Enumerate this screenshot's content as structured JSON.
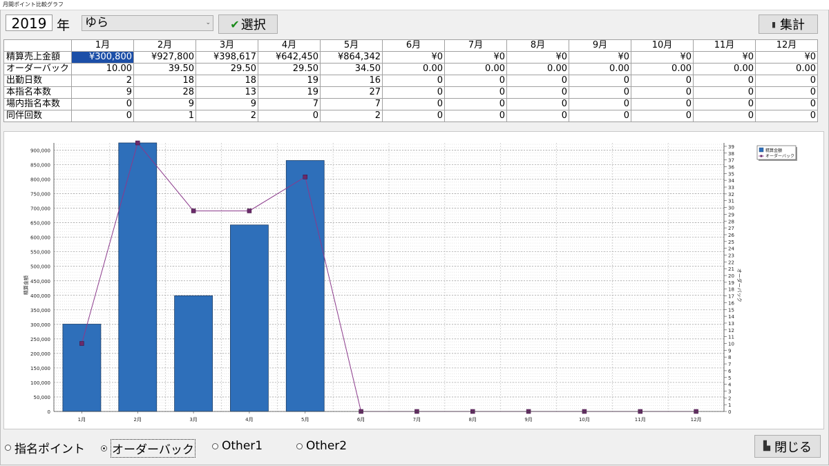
{
  "window": {
    "title": "月間ポイント比較グラフ"
  },
  "toolbar": {
    "year_value": "2019",
    "year_label": "年",
    "staff_selected": "ゆら",
    "select_button": "選択",
    "sum_button": "集計"
  },
  "table": {
    "columns": [
      "1月",
      "2月",
      "3月",
      "4月",
      "5月",
      "6月",
      "7月",
      "8月",
      "9月",
      "10月",
      "11月",
      "12月"
    ],
    "rows": [
      {
        "label": "精算売上金額",
        "values": [
          "¥300,800",
          "¥927,800",
          "¥398,617",
          "¥642,450",
          "¥864,342",
          "¥0",
          "¥0",
          "¥0",
          "¥0",
          "¥0",
          "¥0",
          "¥0"
        ]
      },
      {
        "label": "オーダーバック",
        "values": [
          "10.00",
          "39.50",
          "29.50",
          "29.50",
          "34.50",
          "0.00",
          "0.00",
          "0.00",
          "0.00",
          "0.00",
          "0.00",
          "0.00"
        ]
      },
      {
        "label": "出勤日数",
        "values": [
          "2",
          "18",
          "18",
          "19",
          "16",
          "0",
          "0",
          "0",
          "0",
          "0",
          "0",
          "0"
        ]
      },
      {
        "label": "本指名本数",
        "values": [
          "9",
          "28",
          "13",
          "19",
          "27",
          "0",
          "0",
          "0",
          "0",
          "0",
          "0",
          "0"
        ]
      },
      {
        "label": "場内指名本数",
        "values": [
          "0",
          "9",
          "9",
          "7",
          "7",
          "0",
          "0",
          "0",
          "0",
          "0",
          "0",
          "0"
        ]
      },
      {
        "label": "同伴回数",
        "values": [
          "0",
          "1",
          "2",
          "0",
          "2",
          "0",
          "0",
          "0",
          "0",
          "0",
          "0",
          "0"
        ]
      }
    ]
  },
  "chart_data": {
    "type": "bar",
    "categories": [
      "1月",
      "2月",
      "3月",
      "4月",
      "5月",
      "6月",
      "7月",
      "8月",
      "9月",
      "10月",
      "11月",
      "12月"
    ],
    "series": [
      {
        "name": "精算金額",
        "type": "bar",
        "axis": "left",
        "color": "#2e6fba",
        "values": [
          300800,
          927800,
          398617,
          642450,
          864342,
          0,
          0,
          0,
          0,
          0,
          0,
          0
        ]
      },
      {
        "name": "オーダーバック",
        "type": "line",
        "axis": "right",
        "color": "#8b3a8b",
        "values": [
          10,
          39.5,
          29.5,
          29.5,
          34.5,
          0,
          0,
          0,
          0,
          0,
          0,
          0
        ]
      }
    ],
    "ylabel": "精算金額",
    "y2label": "オーダーバック",
    "ylim": [
      0,
      925000
    ],
    "y2lim": [
      0,
      39.5
    ],
    "yticks": [
      0,
      50000,
      100000,
      150000,
      200000,
      250000,
      300000,
      350000,
      400000,
      450000,
      500000,
      550000,
      600000,
      650000,
      700000,
      750000,
      800000,
      850000,
      900000
    ],
    "ytick_labels": [
      "0",
      "50,000",
      "100,000",
      "150,000",
      "200,000",
      "250,000",
      "300,000",
      "350,000",
      "400,000",
      "450,000",
      "500,000",
      "550,000",
      "600,000",
      "650,000",
      "700,000",
      "750,000",
      "800,000",
      "850,000",
      "900,000"
    ],
    "y2ticks": [
      0,
      1,
      2,
      3,
      4,
      5,
      6,
      7,
      8,
      9,
      10,
      11,
      12,
      13,
      14,
      15,
      16,
      17,
      18,
      19,
      20,
      21,
      22,
      23,
      24,
      25,
      26,
      27,
      28,
      29,
      30,
      31,
      32,
      33,
      34,
      35,
      36,
      37,
      38,
      39
    ],
    "grid": true,
    "legend_position": "top-right"
  },
  "bottom": {
    "radios": [
      {
        "label": "指名ポイント",
        "checked": false
      },
      {
        "label": "オーダーバック",
        "checked": true
      },
      {
        "label": "Other1",
        "checked": false
      },
      {
        "label": "Other2",
        "checked": false
      }
    ],
    "close_button": "閉じる"
  }
}
